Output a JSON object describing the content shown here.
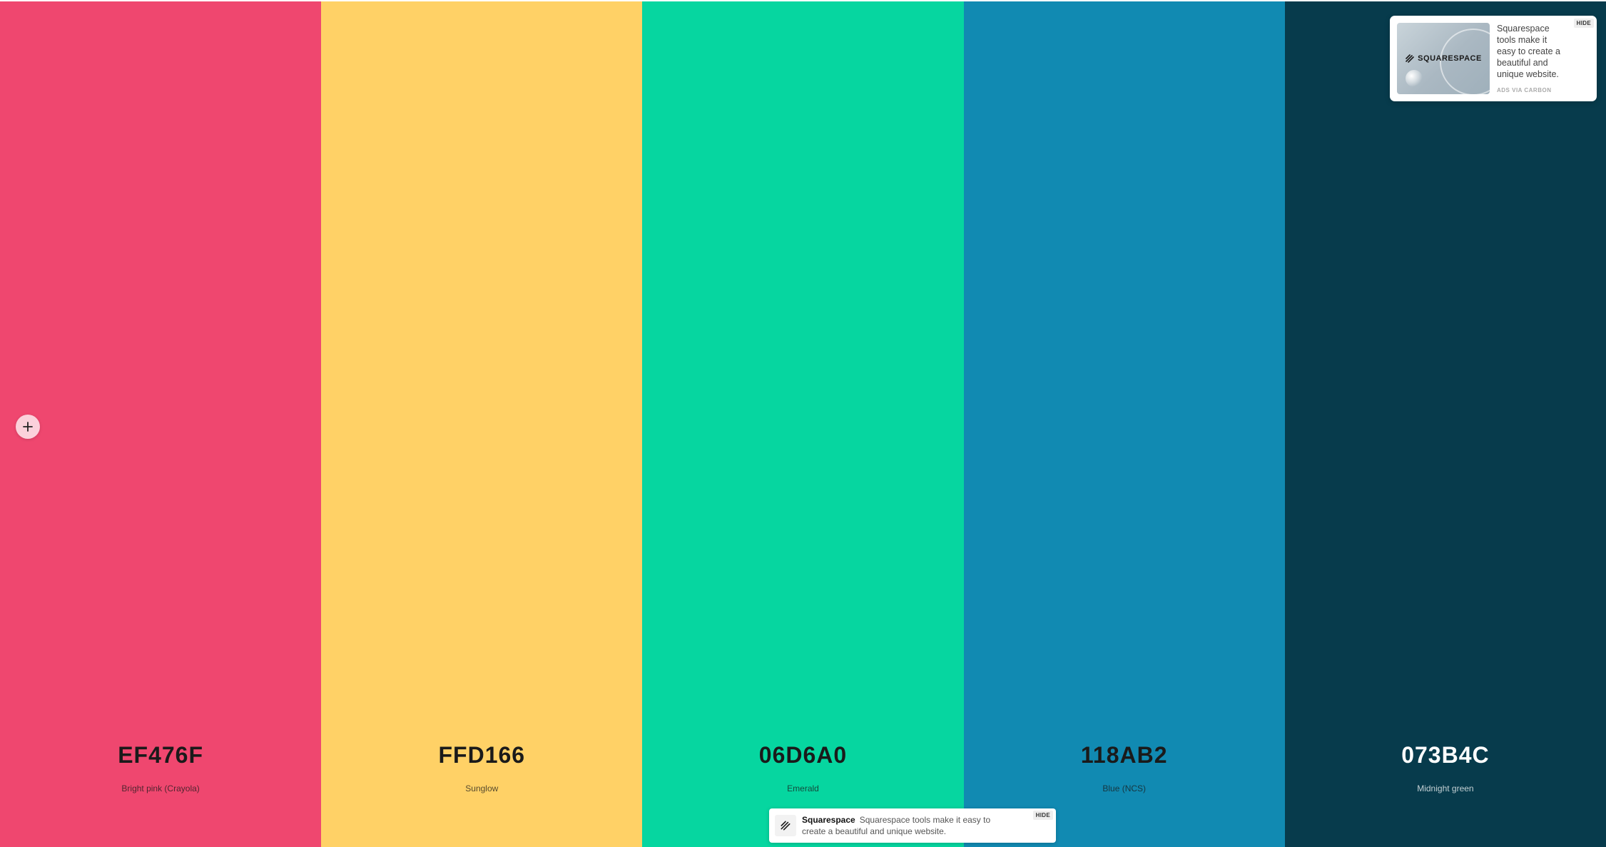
{
  "palette": {
    "colors": [
      {
        "hex": "EF476F",
        "name": "Bright pink (Crayola)",
        "background": "#EF476F",
        "text_color": "#1a1a1a"
      },
      {
        "hex": "FFD166",
        "name": "Sunglow",
        "background": "#FFD166",
        "text_color": "#1a1a1a"
      },
      {
        "hex": "06D6A0",
        "name": "Emerald",
        "background": "#06D6A0",
        "text_color": "#1a1a1a"
      },
      {
        "hex": "118AB2",
        "name": "Blue (NCS)",
        "background": "#118AB2",
        "text_color": "#1a1a1a"
      },
      {
        "hex": "073B4C",
        "name": "Midnight green",
        "background": "#073B4C",
        "text_color": "#ffffff"
      }
    ],
    "add_icon": "plus-icon"
  },
  "ad_card": {
    "brand_logo": "SQUARESPACE",
    "text": "Squarespace tools make it easy to create a beautiful and unique website.",
    "via": "ADS VIA CARBON",
    "hide_label": "HIDE"
  },
  "ad_bar": {
    "brand": "Squarespace",
    "text": "Squarespace tools make it easy to create a beautiful and unique website.",
    "hide_label": "HIDE",
    "icon": "squarespace-logo-icon"
  }
}
